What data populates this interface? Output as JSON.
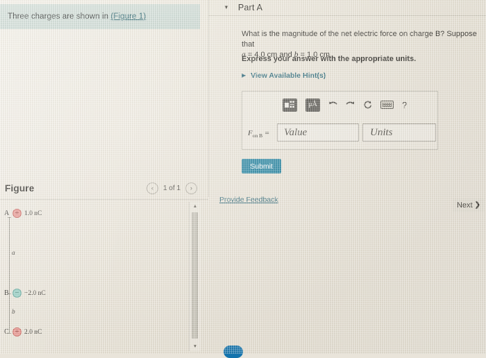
{
  "problem": {
    "text_before_link": "Three charges are shown in ",
    "link_label": "(Figure 1)"
  },
  "part": {
    "caret": "▼",
    "title": "Part A",
    "question_line1": "What is the magnitude of the net electric force on charge B? Suppose that",
    "question_var_a": "a",
    "question_eq_a": " = 4.0 cm and ",
    "question_var_b": "b",
    "question_eq_b": " = 1.0 cm",
    "express": "Express your answer with the appropriate units.",
    "hint_caret": "▶",
    "hint_label": "View Available Hint(s)"
  },
  "answer": {
    "label_main": "F",
    "label_sub": "on B",
    "label_eq": " =",
    "value_placeholder": "Value",
    "units_placeholder": "Units",
    "value_current": "",
    "units_current": "",
    "toolbar": {
      "template_icon": "template-matrix-icon",
      "units_icon": "μÅ",
      "undo_icon": "↶",
      "redo_icon": "↷",
      "reset_icon": "⟳",
      "keyboard_icon": "keyboard-icon",
      "help_icon": "?"
    }
  },
  "actions": {
    "submit_label": "Submit",
    "provide_feedback_label": "Provide Feedback",
    "next_label": "Next",
    "next_chevron": "❯"
  },
  "figure": {
    "title": "Figure",
    "prev_arrow": "‹",
    "next_arrow": "›",
    "counter": "1 of 1",
    "charges": [
      {
        "letter": "A",
        "sign": "+",
        "polarity": "positive",
        "value": "1.0 nC"
      },
      {
        "letter": "B",
        "sign": "−",
        "polarity": "negative",
        "value": "−2.0 nC"
      },
      {
        "letter": "C",
        "sign": "+",
        "polarity": "positive",
        "value": "2.0 nC"
      }
    ],
    "distances": [
      {
        "name": "a",
        "between": "A-B"
      },
      {
        "name": "b",
        "between": "B-C"
      }
    ]
  },
  "scrollbar": {
    "up_arrow": "▲",
    "down_arrow": "▼"
  },
  "colors": {
    "accent_blue": "#1b7f9e",
    "link_teal": "#1e6274",
    "positive_charge": "#e8928c",
    "negative_charge": "#93cdc2",
    "banner_green": "#cedcd6"
  }
}
